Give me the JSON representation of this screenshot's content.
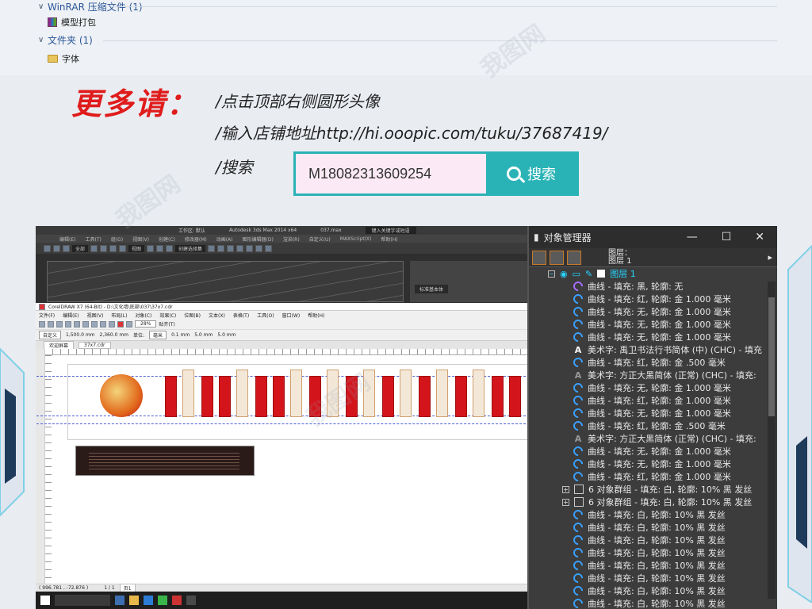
{
  "explorer": {
    "groups": [
      {
        "label": "WinRAR 压缩文件 (1)",
        "items": [
          "模型打包"
        ]
      },
      {
        "label": "文件夹 (1)",
        "items": [
          "字体"
        ]
      }
    ]
  },
  "promo": {
    "headline": "更多请：",
    "line1": "/点击顶部右侧圆形头像",
    "line2": "/输入店铺地址http://hi.ooopic.com/tuku/37687419/",
    "line3": "/搜索",
    "search_value": "M18082313609254",
    "search_button": "搜索"
  },
  "max_window": {
    "title": "Autodesk 3ds Max  2014 x64",
    "file": "037.max",
    "search_placeholder": "键入关键字或短语",
    "menu": [
      "编辑(E)",
      "工具(T)",
      "组(G)",
      "视图(V)",
      "创建(C)",
      "修改器(M)",
      "动画(A)",
      "图形编辑器(D)",
      "渲染(R)",
      "自定义(U)",
      "MAXScript(X)",
      "帮助(H)"
    ],
    "workspace": "工作区: 默认",
    "view_select": "视图",
    "selection": "全部",
    "create_sel": "创建选择集",
    "cmd_label": "标准基本体"
  },
  "corel_window": {
    "title": "CorelDRAW X7 (64-Bit) - D:\\文化墙\\底部\\037\\37x7.cdr",
    "menu": [
      "文件(F)",
      "编辑(E)",
      "视图(V)",
      "布局(L)",
      "对象(C)",
      "效果(C)",
      "位图(B)",
      "文本(X)",
      "表格(T)",
      "工具(O)",
      "窗口(W)",
      "帮助(H)"
    ],
    "zoom": "28%",
    "snap": "贴齐(T)",
    "preset": "自定义",
    "width": "1,500.0 mm",
    "height": "2,360.0 mm",
    "units_label": "单位:",
    "units": "毫米",
    "nudge": "0.1 mm",
    "dup_x": "5.0 mm",
    "dup_y": "5.0 mm",
    "tabs": [
      "欢迎屏幕",
      "37x7.cdr"
    ],
    "page_label": "1 / 1",
    "page_tab": "页1",
    "status": "( 996.781 , -72.876 )"
  },
  "object_manager": {
    "title": "对象管理器",
    "pages_label": "图层：",
    "page_name": "图层 1",
    "layer": "图层 1",
    "rows": [
      {
        "icon": "purple-curve",
        "text": "曲线 - 填充: 黑, 轮廓: 无"
      },
      {
        "icon": "curve",
        "text": "曲线 - 填充: 红, 轮廓: 金  1.000 毫米"
      },
      {
        "icon": "curve",
        "text": "曲线 - 填充: 无, 轮廓: 金  1.000 毫米"
      },
      {
        "icon": "curve",
        "text": "曲线 - 填充: 无, 轮廓: 金  1.000 毫米"
      },
      {
        "icon": "curve",
        "text": "曲线 - 填充: 无, 轮廓: 金  1.000 毫米"
      },
      {
        "icon": "text",
        "text": "美术字:  禹卫书法行书简体 (中) (CHC) - 填充"
      },
      {
        "icon": "curve",
        "text": "曲线 - 填充: 红, 轮廓: 金  .500 毫米"
      },
      {
        "icon": "text-dim",
        "text": "美术字:  方正大黑简体 (正常) (CHC) - 填充:"
      },
      {
        "icon": "curve",
        "text": "曲线 - 填充: 无, 轮廓: 金  1.000 毫米"
      },
      {
        "icon": "curve",
        "text": "曲线 - 填充: 红, 轮廓: 金  1.000 毫米"
      },
      {
        "icon": "curve",
        "text": "曲线 - 填充: 无, 轮廓: 金  1.000 毫米"
      },
      {
        "icon": "curve",
        "text": "曲线 - 填充: 红, 轮廓: 金  .500 毫米"
      },
      {
        "icon": "text-dim",
        "text": "美术字:  方正大黑简体 (正常) (CHC) - 填充:"
      },
      {
        "icon": "curve",
        "text": "曲线 - 填充: 无, 轮廓: 金  1.000 毫米"
      },
      {
        "icon": "curve",
        "text": "曲线 - 填充: 无, 轮廓: 金  1.000 毫米"
      },
      {
        "icon": "curve",
        "text": "曲线 - 填充: 红, 轮廓: 金  1.000 毫米"
      },
      {
        "icon": "group",
        "text": "6 对象群组 - 填充: 白, 轮廓: 10% 黑 发丝"
      },
      {
        "icon": "group",
        "text": "6 对象群组 - 填充: 白, 轮廓: 10% 黑 发丝"
      },
      {
        "icon": "curve",
        "text": "曲线 - 填充: 白, 轮廓: 10% 黑 发丝"
      },
      {
        "icon": "curve",
        "text": "曲线 - 填充: 白, 轮廓: 10% 黑 发丝"
      },
      {
        "icon": "curve",
        "text": "曲线 - 填充: 白, 轮廓: 10% 黑 发丝"
      },
      {
        "icon": "curve",
        "text": "曲线 - 填充: 白, 轮廓: 10% 黑 发丝"
      },
      {
        "icon": "curve",
        "text": "曲线 - 填充: 白, 轮廓: 10% 黑 发丝"
      },
      {
        "icon": "curve",
        "text": "曲线 - 填充: 白, 轮廓: 10% 黑 发丝"
      },
      {
        "icon": "curve",
        "text": "曲线 - 填充: 白, 轮廓: 10% 黑 发丝"
      },
      {
        "icon": "curve",
        "text": "曲线 - 填充: 白, 轮廓: 10% 黑 发丝"
      },
      {
        "icon": "curve",
        "text": "曲线 - 填充: 白, 轮廓: 10% 黑 发丝"
      }
    ]
  },
  "colors": {
    "accent": "#2ab3b6",
    "promo_red": "#e01b1b",
    "layer_blue": "#27d5ff"
  }
}
